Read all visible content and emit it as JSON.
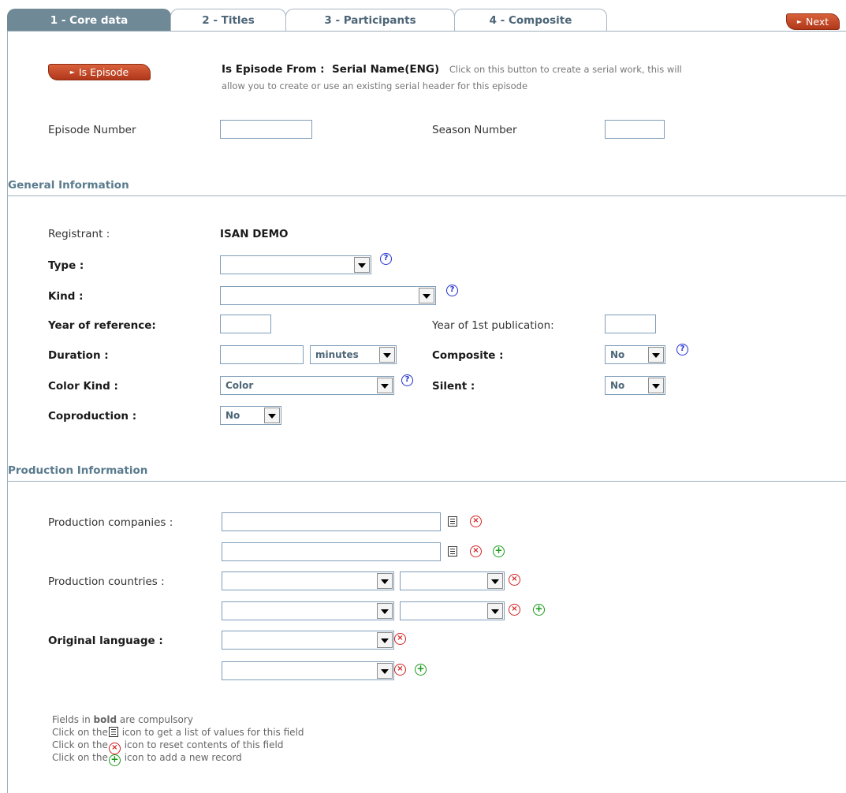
{
  "tabs": [
    {
      "label": "1 - Core data",
      "active": true
    },
    {
      "label": "2 - Titles",
      "active": false
    },
    {
      "label": "3 - Participants",
      "active": false
    },
    {
      "label": "4 - Composite",
      "active": false
    }
  ],
  "next_button": "Next",
  "episode": {
    "button_label": "Is Episode",
    "from_label": "Is Episode From :",
    "serial_name": "Serial Name(ENG)",
    "hint_line1": "Click on this button to create a serial work, this will",
    "hint_line2": "allow you to create or use an existing serial header for this episode",
    "episode_number_label": "Episode Number",
    "episode_number_value": "",
    "season_number_label": "Season Number",
    "season_number_value": ""
  },
  "general": {
    "title": "General Information",
    "registrant_label": "Registrant :",
    "registrant_value": "ISAN DEMO",
    "type_label": "Type :",
    "type_value": "",
    "kind_label": "Kind :",
    "kind_value": "",
    "year_ref_label": "Year of reference:",
    "year_ref_value": "",
    "year_pub_label": "Year of 1st publication:",
    "year_pub_value": "",
    "duration_label": "Duration :",
    "duration_value": "",
    "duration_unit": "minutes",
    "composite_label": "Composite :",
    "composite_value": "No",
    "color_kind_label": "Color Kind :",
    "color_kind_value": "Color",
    "silent_label": "Silent :",
    "silent_value": "No",
    "coproduction_label": "Coproduction :",
    "coproduction_value": "No"
  },
  "production": {
    "title": "Production Information",
    "companies_label": "Production companies :",
    "countries_label": "Production countries :",
    "language_label": "Original language :"
  },
  "legend": {
    "line1_pre": "Fields in ",
    "line1_bold": "bold",
    "line1_post": " are compulsory",
    "click_on_the": "Click on the",
    "line2_post": " icon to get a list of values for this field",
    "line3_post": " icon to reset contents of this field",
    "line4_post": " icon to add a new record"
  },
  "icons": {
    "help": "?",
    "reset": "×",
    "add": "+"
  },
  "colors": {
    "accent_orange": "#c4472a",
    "tab_active": "#6f8997",
    "section_title": "#5a7b8e"
  }
}
